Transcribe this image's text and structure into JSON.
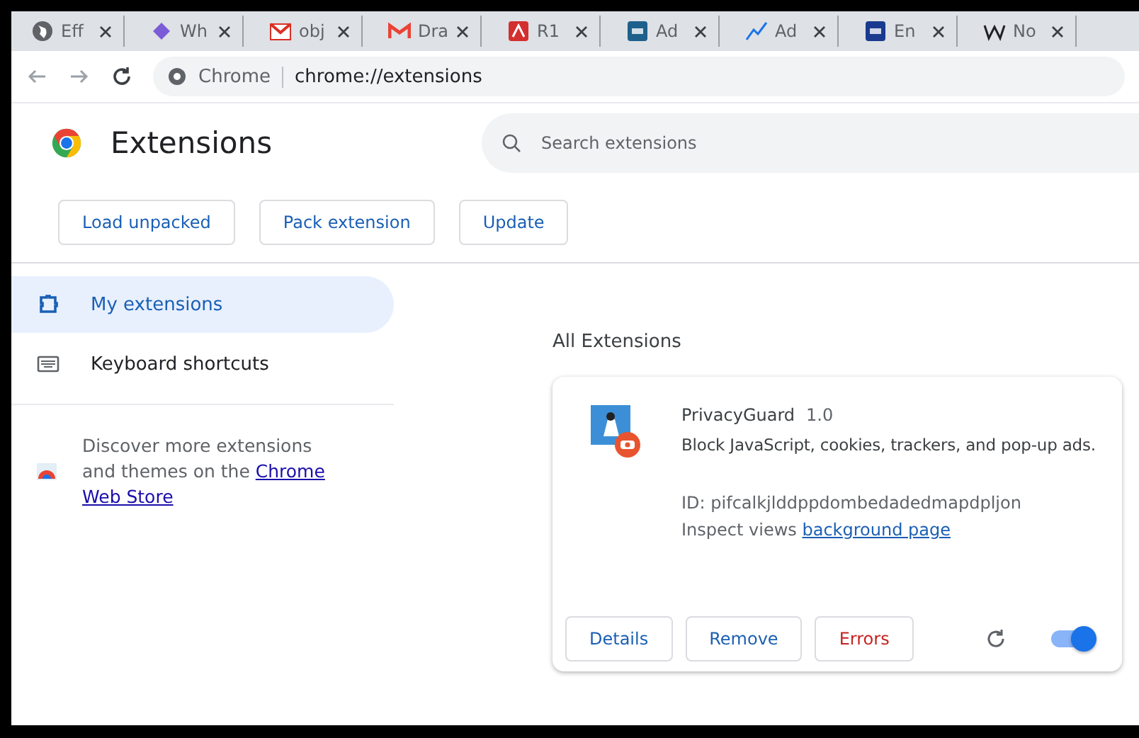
{
  "tabs": [
    {
      "label": "Eff",
      "kind": "globe",
      "color": "#5f6368"
    },
    {
      "label": "Wh",
      "kind": "gem",
      "color": "#7b5cd6"
    },
    {
      "label": "obj",
      "kind": "mailbox",
      "color": "#d93025"
    },
    {
      "label": "Dra",
      "kind": "mail",
      "color": "#ea4335"
    },
    {
      "label": "R1",
      "kind": "pdf",
      "color": "#d32f2f"
    },
    {
      "label": "Ad",
      "kind": "tile",
      "color": "#1f5f8b"
    },
    {
      "label": "Ad",
      "kind": "chart",
      "color": "#1a73e8"
    },
    {
      "label": "En",
      "kind": "tile",
      "color": "#1a3a8f"
    },
    {
      "label": "No",
      "kind": "wiki",
      "color": "#202124"
    }
  ],
  "address_bar": {
    "site_label": "Chrome",
    "url": "chrome://extensions"
  },
  "header": {
    "title": "Extensions",
    "search": {
      "placeholder": "Search extensions"
    }
  },
  "toolbar_buttons": [
    "Load unpacked",
    "Pack extension",
    "Update"
  ],
  "sidebar": {
    "items": [
      {
        "label": "My extensions",
        "kind": "puzzle",
        "selected": true
      },
      {
        "label": "Keyboard shortcuts",
        "kind": "keyboard",
        "selected": false
      }
    ],
    "discover": {
      "text_before": "Discover more extensions and themes on the ",
      "link_parts": [
        "Chrome",
        "Web Store"
      ]
    }
  },
  "section_title": "All Extensions",
  "extension": {
    "name": "PrivacyGuard",
    "version": "1.0",
    "description": "Block JavaScript, cookies, trackers, and pop-up ads.",
    "id": "ID: pifcalkjlddppdombedadedmapdpljon",
    "inspect_label": "Inspect views",
    "inspect_link": "background page",
    "buttons": [
      {
        "label": "Details",
        "kind": "normal"
      },
      {
        "label": "Remove",
        "kind": "normal"
      },
      {
        "label": "Errors",
        "kind": "error"
      }
    ],
    "enabled": true
  }
}
